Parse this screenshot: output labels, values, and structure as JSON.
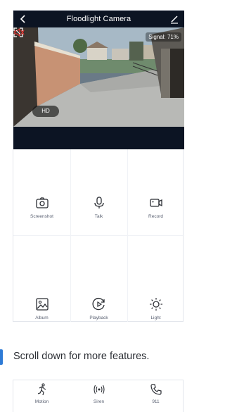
{
  "header": {
    "title": "Floodlight Camera",
    "back_icon": "back-chevron-icon",
    "edit_icon": "edit-pencil-icon",
    "background": "#0c1423"
  },
  "video": {
    "signal_text": "Signal: 71%",
    "quality_label": "HD",
    "mute_icon": "speaker-muted-icon",
    "fullscreen_icon": "fullscreen-icon",
    "mute_color": "#e53935"
  },
  "features": [
    {
      "label": "Screenshot",
      "icon": "camera-icon"
    },
    {
      "label": "Talk",
      "icon": "microphone-icon"
    },
    {
      "label": "Record",
      "icon": "video-record-icon"
    },
    {
      "label": "Album",
      "icon": "image-icon"
    },
    {
      "label": "Playback",
      "icon": "playback-icon"
    },
    {
      "label": "Light",
      "icon": "sun-icon"
    }
  ],
  "note": {
    "text": "Scroll down for more features.",
    "accent": "#2e7bd6"
  },
  "more_features": [
    {
      "label": "Motion",
      "icon": "running-person-icon"
    },
    {
      "label": "Siren",
      "icon": "siren-icon"
    },
    {
      "label": "911",
      "icon": "phone-icon"
    }
  ]
}
